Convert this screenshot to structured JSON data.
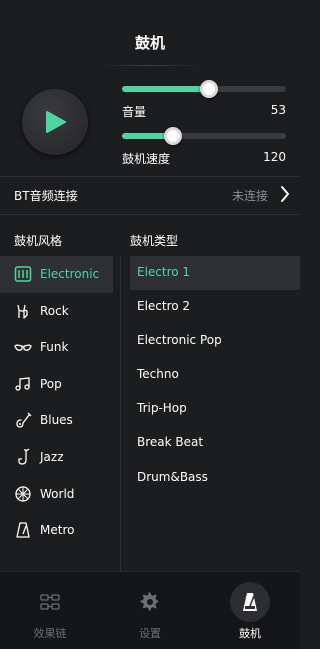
{
  "header": {
    "title": "鼓机"
  },
  "player": {
    "play_icon": "play-icon",
    "accent": "#4fd6a0"
  },
  "volume": {
    "label": "音量",
    "value": "53",
    "fraction": 0.53
  },
  "tempo": {
    "label": "鼓机速度",
    "value": "120",
    "fraction": 0.31
  },
  "bt": {
    "label": "BT音频连接",
    "status": "未连接"
  },
  "styles": {
    "heading": "鼓机风格",
    "items": [
      {
        "label": "Electronic",
        "icon": "electronic-icon",
        "active": true
      },
      {
        "label": "Rock",
        "icon": "rock-hand-icon"
      },
      {
        "label": "Funk",
        "icon": "funk-glasses-icon"
      },
      {
        "label": "Pop",
        "icon": "music-notes-icon"
      },
      {
        "label": "Blues",
        "icon": "guitar-icon"
      },
      {
        "label": "Jazz",
        "icon": "saxophone-icon"
      },
      {
        "label": "World",
        "icon": "globe-icon"
      },
      {
        "label": "Metro",
        "icon": "metronome-icon"
      }
    ]
  },
  "types": {
    "heading": "鼓机类型",
    "items": [
      {
        "label": "Electro 1",
        "active": true
      },
      {
        "label": "Electro 2"
      },
      {
        "label": "Electronic Pop"
      },
      {
        "label": "Techno"
      },
      {
        "label": "Trip-Hop"
      },
      {
        "label": "Break Beat"
      },
      {
        "label": "Drum&Bass"
      }
    ]
  },
  "tabs": [
    {
      "label": "效果链",
      "icon": "effects-chain-icon"
    },
    {
      "label": "设置",
      "icon": "gear-icon"
    },
    {
      "label": "鼓机",
      "icon": "metronome-icon",
      "active": true
    }
  ]
}
